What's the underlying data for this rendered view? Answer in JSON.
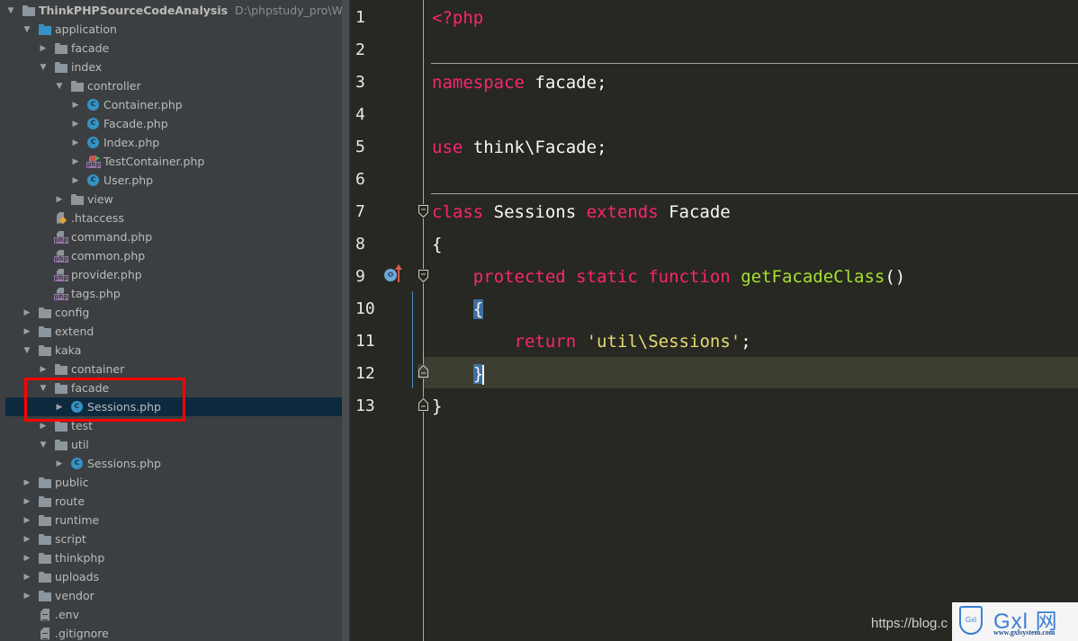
{
  "project": {
    "name": "ThinkPHPSourceCodeAnalysis",
    "path": "D:\\phpstudy_pro\\WWW\\Th"
  },
  "tree": [
    {
      "label": "application",
      "type": "folder",
      "expanded": true,
      "depth": 1,
      "icon": "folder-blue-icon"
    },
    {
      "label": "facade",
      "type": "folder",
      "expanded": false,
      "depth": 2,
      "icon": "folder-icon"
    },
    {
      "label": "index",
      "type": "folder",
      "expanded": true,
      "depth": 2,
      "icon": "folder-icon"
    },
    {
      "label": "controller",
      "type": "folder",
      "expanded": true,
      "depth": 3,
      "icon": "folder-icon"
    },
    {
      "label": "Container.php",
      "type": "class",
      "expanded": false,
      "depth": 4,
      "icon": "php-class-icon"
    },
    {
      "label": "Facade.php",
      "type": "class",
      "expanded": false,
      "depth": 4,
      "icon": "php-class-icon"
    },
    {
      "label": "Index.php",
      "type": "class",
      "expanded": false,
      "depth": 4,
      "icon": "php-class-icon"
    },
    {
      "label": "TestContainer.php",
      "type": "test",
      "expanded": false,
      "depth": 4,
      "icon": "php-test-icon"
    },
    {
      "label": "User.php",
      "type": "class",
      "expanded": false,
      "depth": 4,
      "icon": "php-class-icon"
    },
    {
      "label": "view",
      "type": "folder",
      "expanded": false,
      "depth": 3,
      "icon": "folder-icon"
    },
    {
      "label": ".htaccess",
      "type": "htaccess",
      "depth": 2,
      "icon": "htaccess-file-icon"
    },
    {
      "label": "command.php",
      "type": "php",
      "depth": 2,
      "icon": "php-file-icon"
    },
    {
      "label": "common.php",
      "type": "php",
      "depth": 2,
      "icon": "php-file-icon"
    },
    {
      "label": "provider.php",
      "type": "php",
      "depth": 2,
      "icon": "php-file-icon"
    },
    {
      "label": "tags.php",
      "type": "php",
      "depth": 2,
      "icon": "php-file-icon"
    },
    {
      "label": "config",
      "type": "folder",
      "expanded": false,
      "depth": 1,
      "icon": "folder-icon"
    },
    {
      "label": "extend",
      "type": "folder",
      "expanded": false,
      "depth": 1,
      "icon": "folder-icon"
    },
    {
      "label": "kaka",
      "type": "folder",
      "expanded": true,
      "depth": 1,
      "icon": "folder-icon"
    },
    {
      "label": "container",
      "type": "folder",
      "expanded": false,
      "depth": 2,
      "icon": "folder-icon"
    },
    {
      "label": "facade",
      "type": "folder",
      "expanded": true,
      "depth": 2,
      "icon": "folder-icon"
    },
    {
      "label": "Sessions.php",
      "type": "class",
      "expanded": false,
      "depth": 3,
      "icon": "php-class-icon",
      "selected": true
    },
    {
      "label": "test",
      "type": "folder",
      "expanded": false,
      "depth": 2,
      "icon": "folder-icon"
    },
    {
      "label": "util",
      "type": "folder",
      "expanded": true,
      "depth": 2,
      "icon": "folder-icon"
    },
    {
      "label": "Sessions.php",
      "type": "class",
      "expanded": false,
      "depth": 3,
      "icon": "php-class-icon"
    },
    {
      "label": "public",
      "type": "folder",
      "expanded": false,
      "depth": 1,
      "icon": "folder-icon"
    },
    {
      "label": "route",
      "type": "folder",
      "expanded": false,
      "depth": 1,
      "icon": "folder-icon"
    },
    {
      "label": "runtime",
      "type": "folder",
      "expanded": false,
      "depth": 1,
      "icon": "folder-icon"
    },
    {
      "label": "script",
      "type": "folder",
      "expanded": false,
      "depth": 1,
      "icon": "folder-icon"
    },
    {
      "label": "thinkphp",
      "type": "folder",
      "expanded": false,
      "depth": 1,
      "icon": "folder-icon"
    },
    {
      "label": "uploads",
      "type": "folder",
      "expanded": false,
      "depth": 1,
      "icon": "folder-icon"
    },
    {
      "label": "vendor",
      "type": "folder",
      "expanded": false,
      "depth": 1,
      "icon": "folder-icon"
    },
    {
      "label": ".env",
      "type": "text",
      "depth": 1,
      "icon": "text-file-icon"
    },
    {
      "label": ".gitignore",
      "type": "text",
      "depth": 1,
      "icon": "text-file-icon"
    }
  ],
  "editor": {
    "current_line": 12,
    "lines": [
      {
        "n": "1",
        "tokens": [
          {
            "t": "<?php",
            "c": "kw"
          }
        ]
      },
      {
        "n": "2",
        "tokens": []
      },
      {
        "n": "3",
        "tokens": [
          {
            "t": "namespace",
            "c": "kw"
          },
          {
            "t": " facade;",
            "c": ""
          }
        ]
      },
      {
        "n": "4",
        "tokens": []
      },
      {
        "n": "5",
        "tokens": [
          {
            "t": "use",
            "c": "kw"
          },
          {
            "t": " think\\Facade;",
            "c": ""
          }
        ]
      },
      {
        "n": "6",
        "tokens": []
      },
      {
        "n": "7",
        "tokens": [
          {
            "t": "class",
            "c": "kw"
          },
          {
            "t": " Sessions ",
            "c": ""
          },
          {
            "t": "extends",
            "c": "kw"
          },
          {
            "t": " Facade",
            "c": ""
          }
        ]
      },
      {
        "n": "8",
        "tokens": [
          {
            "t": "{",
            "c": ""
          }
        ]
      },
      {
        "n": "9",
        "tokens": [
          {
            "t": "    ",
            "c": ""
          },
          {
            "t": "protected static function",
            "c": "kw"
          },
          {
            "t": " ",
            "c": ""
          },
          {
            "t": "getFacadeClass",
            "c": "fn"
          },
          {
            "t": "()",
            "c": ""
          }
        ]
      },
      {
        "n": "10",
        "tokens": [
          {
            "t": "    ",
            "c": ""
          },
          {
            "t": "{",
            "c": "brace-hl"
          }
        ]
      },
      {
        "n": "11",
        "tokens": [
          {
            "t": "        ",
            "c": ""
          },
          {
            "t": "return",
            "c": "kw"
          },
          {
            "t": " ",
            "c": ""
          },
          {
            "t": "'util\\Sessions'",
            "c": "str"
          },
          {
            "t": ";",
            "c": ""
          }
        ]
      },
      {
        "n": "12",
        "tokens": [
          {
            "t": "    ",
            "c": ""
          },
          {
            "t": "}",
            "c": "brace-hl"
          },
          {
            "t": "",
            "c": "caret"
          }
        ]
      },
      {
        "n": "13",
        "tokens": [
          {
            "t": "}",
            "c": ""
          }
        ]
      }
    ],
    "override_marker": {
      "line": 9,
      "icon": "override-method-icon",
      "label": "o"
    }
  },
  "watermark": {
    "url": "https://blog.c",
    "brand": "Gxl 网",
    "shield_text": "Gxl",
    "site": "www.gxlsystem.com"
  }
}
